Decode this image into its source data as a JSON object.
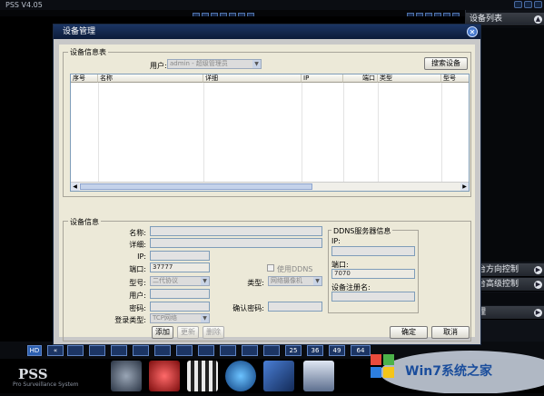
{
  "app": {
    "title": "PSS  V4.05",
    "brand": "PSS",
    "brand_sub": "Pro Surveillance System",
    "watermark_text": "Win7系统之家"
  },
  "right_panel": {
    "device_list_title": "设备列表",
    "ptz_title": "云台方向控制",
    "advanced_title": "云台高级控制",
    "manage_title": "管理"
  },
  "toolbar": {
    "hd_label": "HD",
    "view_counts": [
      "25",
      "36",
      "49",
      "64"
    ]
  },
  "dialog": {
    "title": "设备管理",
    "close_glyph": "✕",
    "device_list_group": "设备信息表",
    "user_label": "用户:",
    "user_value": "admin - 超级管理员",
    "search_button": "搜索设备",
    "table": {
      "columns": [
        "序号",
        "名称",
        "详细",
        "IP",
        "端口",
        "类型",
        "型号"
      ]
    },
    "device_info_group": "设备信息",
    "form": {
      "name_label": "名称:",
      "name_value": "",
      "detail_label": "详细:",
      "detail_value": "",
      "ip_label": "IP:",
      "ip_value": "",
      "port_label": "端口:",
      "port_value": "37777",
      "model_label": "型号:",
      "model_value": "二代协议",
      "use_ddns_label": "使用DDNS",
      "type_label": "类型:",
      "type_value": "网络摄像机",
      "user_label": "用户:",
      "user_value": "",
      "password_label": "密码:",
      "password_value": "",
      "confirm_password_label": "确认密码:",
      "confirm_password_value": "",
      "login_type_label": "登录类型:",
      "login_type_value": "TCP网络"
    },
    "ddns": {
      "group": "DDNS服务器信息",
      "ip_label": "IP:",
      "ip_value": "",
      "port_label": "端口:",
      "port_value": "7070",
      "reg_label": "设备注册名:",
      "reg_value": ""
    },
    "buttons": {
      "add": "添加",
      "update": "更新",
      "delete": "删除",
      "ok": "确定",
      "cancel": "取消"
    }
  },
  "colors": {
    "dialog_title_bg": "#0c1b38",
    "dialog_body_bg": "#ece9d8",
    "accent_blue": "#1c3564"
  }
}
